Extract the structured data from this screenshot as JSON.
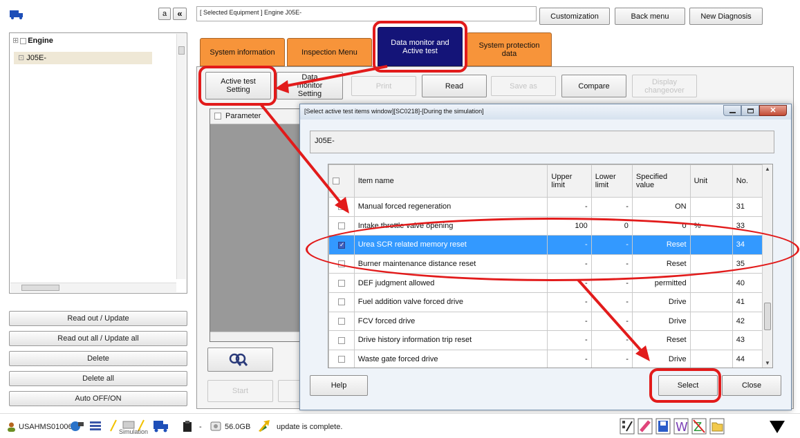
{
  "sidebar": {
    "buttons": {
      "a": "a",
      "collapse": "«"
    },
    "tree": {
      "root": "Engine",
      "child": "J05E-"
    },
    "actions": [
      "Read out / Update",
      "Read out all / Update all",
      "Delete",
      "Delete all",
      "Auto OFF/ON"
    ]
  },
  "header": {
    "selected_equipment": "[ Selected Equipment ] Engine J05E-",
    "customization": "Customization",
    "back_menu": "Back menu",
    "new_diagnosis": "New Diagnosis"
  },
  "tabs": [
    "System information",
    "Inspection Menu",
    "Data monitor and Active test",
    "System protection data"
  ],
  "toolbar": {
    "active_test_setting": "Active test Setting",
    "data_monitor_setting": "Data monitor Setting",
    "print": "Print",
    "read": "Read",
    "save_as": "Save as",
    "compare": "Compare",
    "display_changeover": "Display changeover"
  },
  "left_panel": {
    "parameter_header": "Parameter",
    "start": "Start"
  },
  "dialog": {
    "title": "[Select active test items window][SC0218]-[During the simulation]",
    "model": "J05E-",
    "columns": {
      "item": "Item name",
      "upper": "Upper limit",
      "lower": "Lower limit",
      "specified": "Specified value",
      "unit": "Unit",
      "no": "No."
    },
    "rows": [
      {
        "name": "Manual forced regeneration",
        "upper": "-",
        "lower": "-",
        "value": "ON",
        "unit": "",
        "no": "31",
        "checked": false
      },
      {
        "name": "Intake throttle valve opening",
        "upper": "100",
        "lower": "0",
        "value": "0",
        "unit": "%",
        "no": "33",
        "checked": false
      },
      {
        "name": "Urea SCR related memory reset",
        "upper": "-",
        "lower": "-",
        "value": "Reset",
        "unit": "",
        "no": "34",
        "checked": true
      },
      {
        "name": "Burner maintenance distance reset",
        "upper": "-",
        "lower": "-",
        "value": "Reset",
        "unit": "",
        "no": "35",
        "checked": false
      },
      {
        "name": "DEF judgment allowed",
        "upper": "-",
        "lower": "-",
        "value": "permitted",
        "unit": "",
        "no": "40",
        "checked": false
      },
      {
        "name": "Fuel addition valve forced drive",
        "upper": "-",
        "lower": "-",
        "value": "Drive",
        "unit": "",
        "no": "41",
        "checked": false
      },
      {
        "name": "FCV forced drive",
        "upper": "-",
        "lower": "-",
        "value": "Drive",
        "unit": "",
        "no": "42",
        "checked": false
      },
      {
        "name": "Drive history information trip reset",
        "upper": "-",
        "lower": "-",
        "value": "Reset",
        "unit": "",
        "no": "43",
        "checked": false
      },
      {
        "name": "Waste gate forced drive",
        "upper": "-",
        "lower": "-",
        "value": "Drive",
        "unit": "",
        "no": "44",
        "checked": false
      }
    ],
    "help": "Help",
    "select": "Select",
    "close": "Close"
  },
  "taskbar": {
    "user": "USAHMS010063",
    "simulation": "Simulation",
    "disk": "56.0GB",
    "status": "update is complete."
  },
  "colors": {
    "tab_orange": "#f7943a",
    "tab_active": "#141478",
    "selection": "#3399ff",
    "annotation_red": "#e21b1b"
  }
}
